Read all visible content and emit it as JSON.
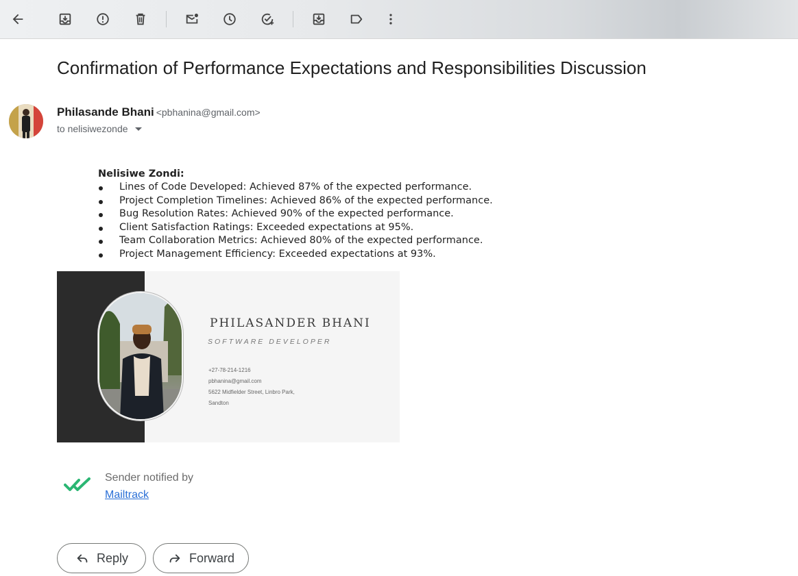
{
  "toolbar": {
    "icons": [
      "back-arrow-icon",
      "archive-icon",
      "report-spam-icon",
      "delete-icon",
      "mark-unread-icon",
      "snooze-icon",
      "add-to-tasks-icon",
      "move-to-icon",
      "label-icon",
      "more-options-icon"
    ]
  },
  "email": {
    "subject": "Confirmation of Performance Expectations and Responsibilities Discussion",
    "sender_name": "Philasande Bhani",
    "sender_email": "<pbhanina@gmail.com>",
    "recipient": "to nelisiwezonde",
    "body_heading": "Nelisiwe Zondi:",
    "body_items": [
      "Lines of Code Developed: Achieved 87% of the expected performance.",
      "Project Completion Timelines: Achieved 86% of the expected performance.",
      "Bug Resolution Rates: Achieved 90% of the expected performance.",
      "Client Satisfaction Ratings: Exceeded expectations at 95%.",
      "Team Collaboration Metrics: Achieved 80% of the expected performance.",
      "Project Management Efficiency: Exceeded expectations at 93%."
    ]
  },
  "signature_card": {
    "name": "PHILASANDER BHANI",
    "role": "SOFTWARE DEVELOPER",
    "phone": "+27-78-214-1216",
    "email": "pbhanina@gmail.com",
    "address_line1": "5622 Midfielder Street, Linbro Park,",
    "address_line2": "Sandton"
  },
  "mailtrack": {
    "notice": "Sender notified by",
    "link_text": "Mailtrack",
    "accent_color": "#2bb673"
  },
  "actions": {
    "reply_label": "Reply",
    "forward_label": "Forward"
  }
}
